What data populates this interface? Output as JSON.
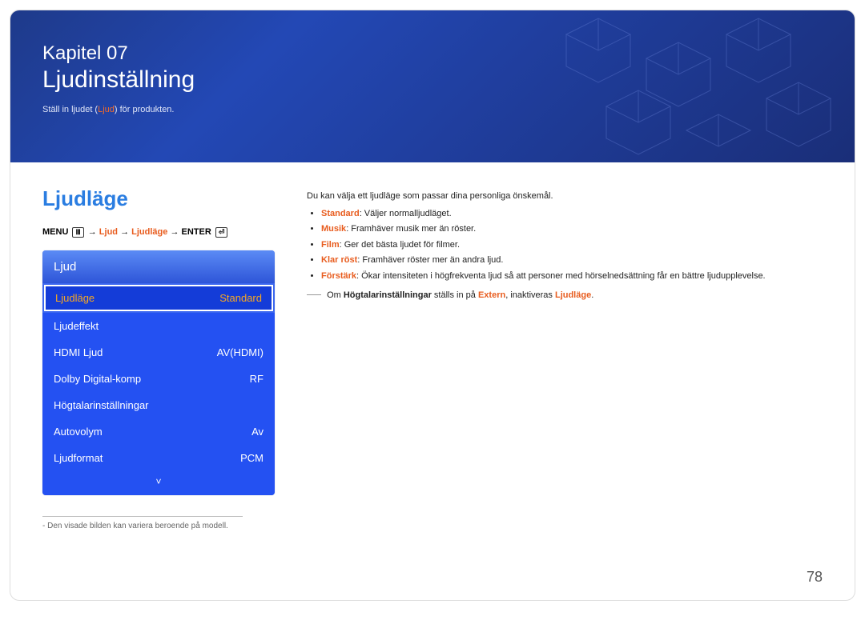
{
  "hero": {
    "chapter": "Kapitel 07",
    "title": "Ljudinställning",
    "sub_pre": "Ställ in ljudet (",
    "sub_highlight": "Ljud",
    "sub_post": ") för produkten."
  },
  "section_title": "Ljudläge",
  "breadcrumb": {
    "menu": "MENU",
    "arrow": " → ",
    "ljud": "Ljud",
    "ljudlage": "Ljudläge",
    "enter": "ENTER"
  },
  "panel": {
    "header": "Ljud",
    "rows": [
      {
        "label": "Ljudläge",
        "value": "Standard",
        "selected": true
      },
      {
        "label": "Ljudeffekt",
        "value": "",
        "selected": false
      },
      {
        "label": "HDMI Ljud",
        "value": "AV(HDMI)",
        "selected": false
      },
      {
        "label": "Dolby Digital-komp",
        "value": "RF",
        "selected": false
      },
      {
        "label": "Högtalarinställningar",
        "value": "",
        "selected": false
      },
      {
        "label": "Autovolym",
        "value": "Av",
        "selected": false
      },
      {
        "label": "Ljudformat",
        "value": "PCM",
        "selected": false
      }
    ],
    "chevron": "˅"
  },
  "footnote_dash": "-",
  "footnote": " Den visade bilden kan variera beroende på modell.",
  "description": {
    "intro": "Du kan välja ett ljudläge som passar dina personliga önskemål.",
    "bullets": [
      {
        "term": "Standard",
        "text": ": Väljer normalljudläget."
      },
      {
        "term": "Musik",
        "text": ": Framhäver musik mer än röster."
      },
      {
        "term": "Film",
        "text": ": Ger det bästa ljudet för filmer."
      },
      {
        "term": "Klar röst",
        "text": ": Framhäver röster mer än andra ljud."
      },
      {
        "term": "Förstärk",
        "text": ": Ökar intensiteten i högfrekventa ljud så att personer med hörselnedsättning får en bättre ljudupplevelse."
      }
    ],
    "note_pre": "Om ",
    "note_bold1": "Högtalarinställningar",
    "note_mid": " ställs in på ",
    "note_bold2": "Extern",
    "note_mid2": ", inaktiveras ",
    "note_bold3": "Ljudläge",
    "note_post": "."
  },
  "page_number": "78"
}
